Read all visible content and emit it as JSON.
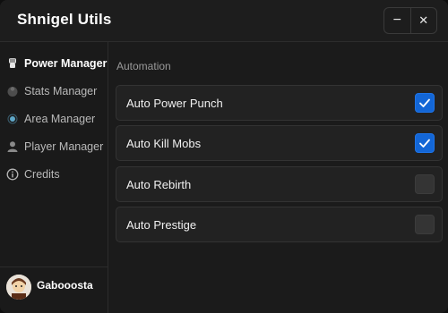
{
  "window": {
    "title": "Shnigel Utils",
    "minimize_glyph": "−",
    "close_glyph": "✕"
  },
  "sidebar": {
    "items": [
      {
        "label": "Power Manager",
        "icon": "fist-icon",
        "active": true
      },
      {
        "label": "Stats Manager",
        "icon": "stats-icon",
        "active": false
      },
      {
        "label": "Area Manager",
        "icon": "area-icon",
        "active": false
      },
      {
        "label": "Player Manager",
        "icon": "player-icon",
        "active": false
      },
      {
        "label": "Credits",
        "icon": "info-icon",
        "active": false
      }
    ]
  },
  "user": {
    "name": "Gabooosta"
  },
  "main": {
    "section_title": "Automation",
    "toggles": [
      {
        "label": "Auto Power Punch",
        "checked": true
      },
      {
        "label": "Auto Kill Mobs",
        "checked": true
      },
      {
        "label": "Auto Rebirth",
        "checked": false
      },
      {
        "label": "Auto Prestige",
        "checked": false
      }
    ]
  },
  "colors": {
    "accent": "#1366d6",
    "background": "#1b1b1b",
    "row": "#222222"
  }
}
